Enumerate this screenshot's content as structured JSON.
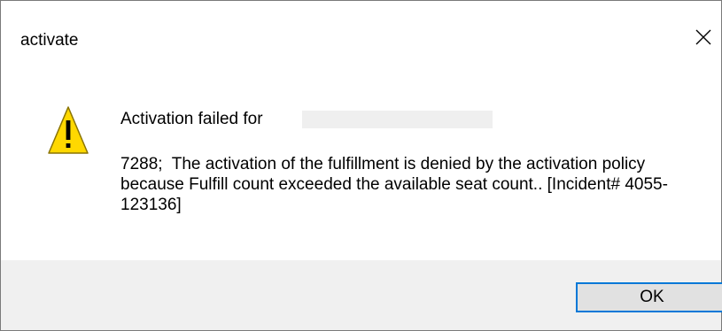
{
  "window": {
    "title": "activate",
    "close_icon": "close-icon"
  },
  "dialog": {
    "icon": "warning-icon",
    "heading": "Activation failed for",
    "message": "7288;  The activation of the fulfillment is denied by the activation policy because Fulfill count exceeded the available seat count.. [Incident# 4055-123136]"
  },
  "footer": {
    "ok_label": "OK"
  },
  "colors": {
    "accent": "#0078d7",
    "warning": "#ffd800",
    "footer_bg": "#f0f0f0",
    "button_bg": "#e1e1e1"
  }
}
